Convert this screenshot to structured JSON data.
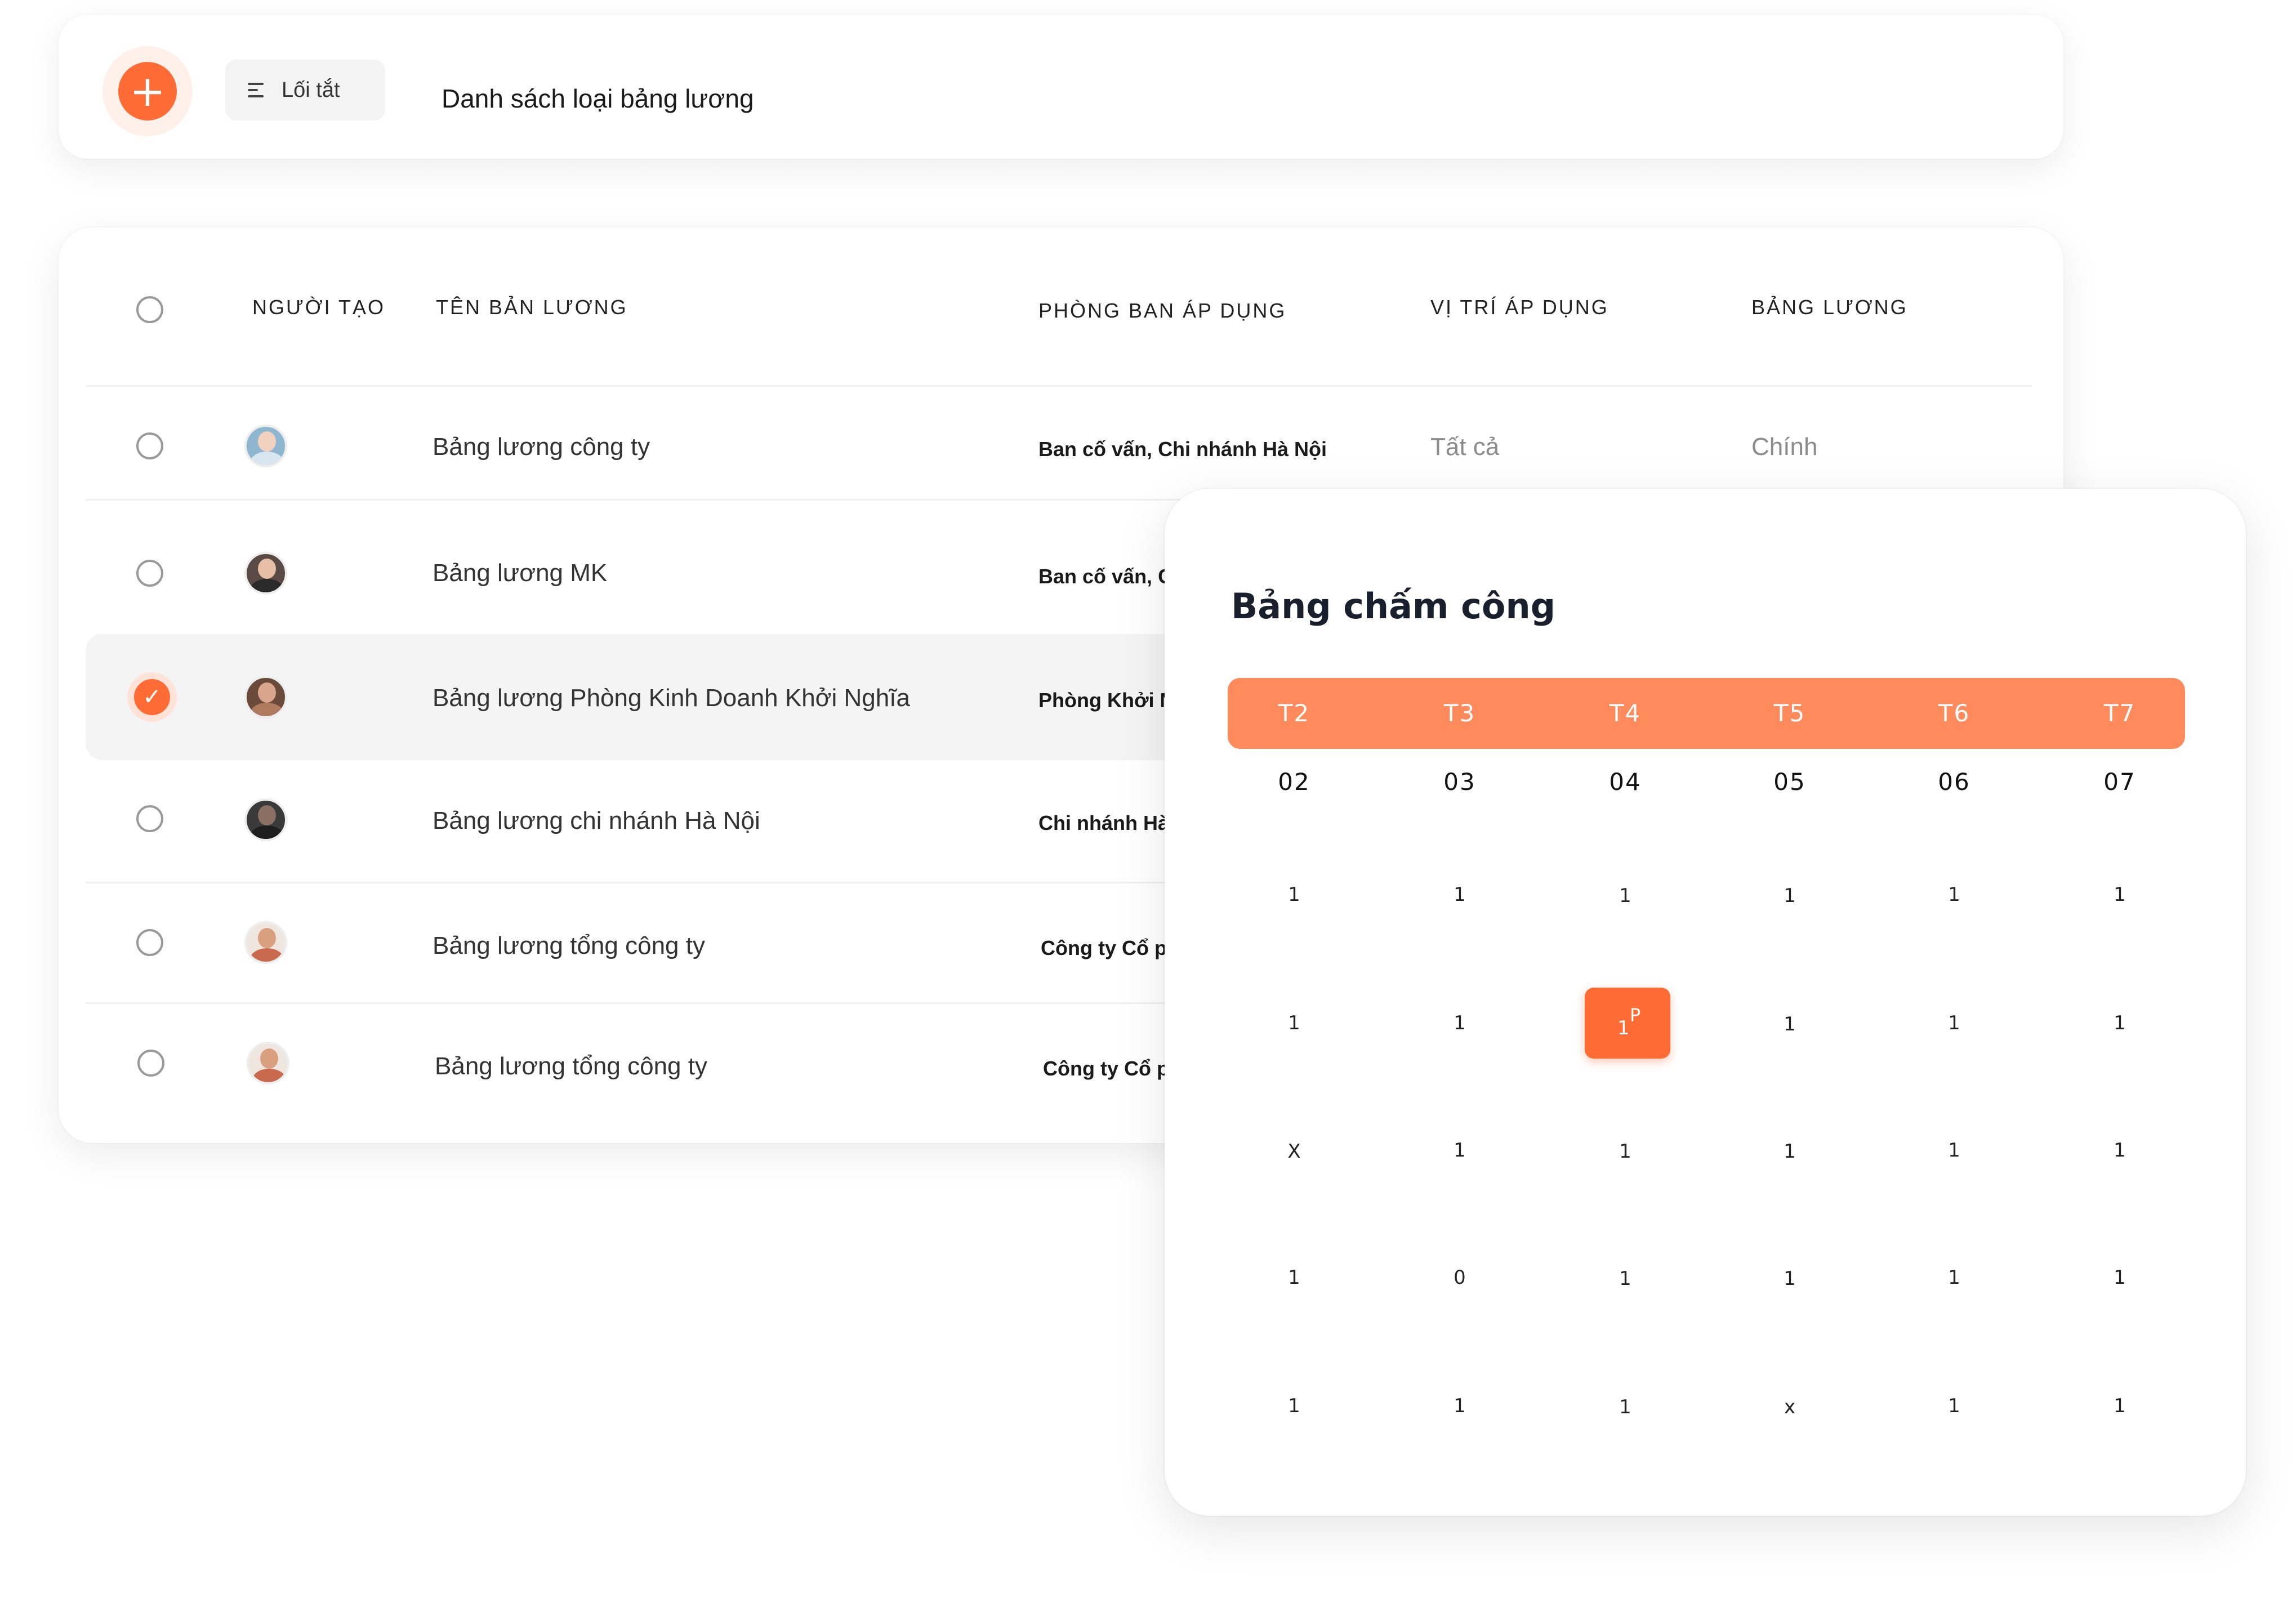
{
  "header": {
    "add_icon": "plus-icon",
    "shortcut_label": "Lối tắt",
    "shortcut_icon": "menu-lines-icon",
    "title": "Danh sách loại bảng lương"
  },
  "table": {
    "columns": [
      "NGƯỜI TẠO",
      "TÊN BẢN LƯƠNG",
      "PHÒNG BAN ÁP DỤNG",
      "VỊ TRÍ ÁP DỤNG",
      "BẢNG LƯƠNG"
    ],
    "rows": [
      {
        "name": "Bảng lương công ty",
        "department": "Ban cố vấn, Chi nhánh Hà Nội",
        "position": "Tất cả",
        "payroll": "Chính",
        "selected": false
      },
      {
        "name": "Bảng lương MK",
        "department": "Ban cố vấn, C",
        "position": "",
        "payroll": "",
        "selected": false
      },
      {
        "name": "Bảng lương Phòng Kinh Doanh Khởi Nghĩa",
        "department": "Phòng Khởi N",
        "position": "",
        "payroll": "",
        "selected": true
      },
      {
        "name": "Bảng lương chi nhánh Hà Nội",
        "department": "Chi nhánh Hà",
        "position": "",
        "payroll": "",
        "selected": false
      },
      {
        "name": "Bảng lương tổng công ty",
        "department": "Công ty Cổ pl",
        "position": "",
        "payroll": "",
        "selected": false
      },
      {
        "name": "Bảng lương tổng công ty",
        "department": "Công ty Cổ pl",
        "position": "",
        "payroll": "",
        "selected": false
      }
    ]
  },
  "timesheet": {
    "title": "Bảng chấm công",
    "days": [
      "T2",
      "T3",
      "T4",
      "T5",
      "T6",
      "T7"
    ],
    "dates": [
      "02",
      "03",
      "04",
      "05",
      "06",
      "07"
    ],
    "grid": [
      [
        "1",
        "1",
        "1",
        "1",
        "1",
        "1"
      ],
      [
        "1",
        "1",
        "1",
        "1",
        "1",
        "1"
      ],
      [
        "X",
        "1",
        "1",
        "1",
        "1",
        "1"
      ],
      [
        "1",
        "0",
        "1",
        "1",
        "1",
        "1"
      ],
      [
        "1",
        "1",
        "1",
        "x",
        "1",
        "1"
      ]
    ],
    "highlight": {
      "value": "1",
      "superscript": "P"
    }
  },
  "colors": {
    "accent": "#ff6b35",
    "header_bar": "#ff8a5c"
  }
}
